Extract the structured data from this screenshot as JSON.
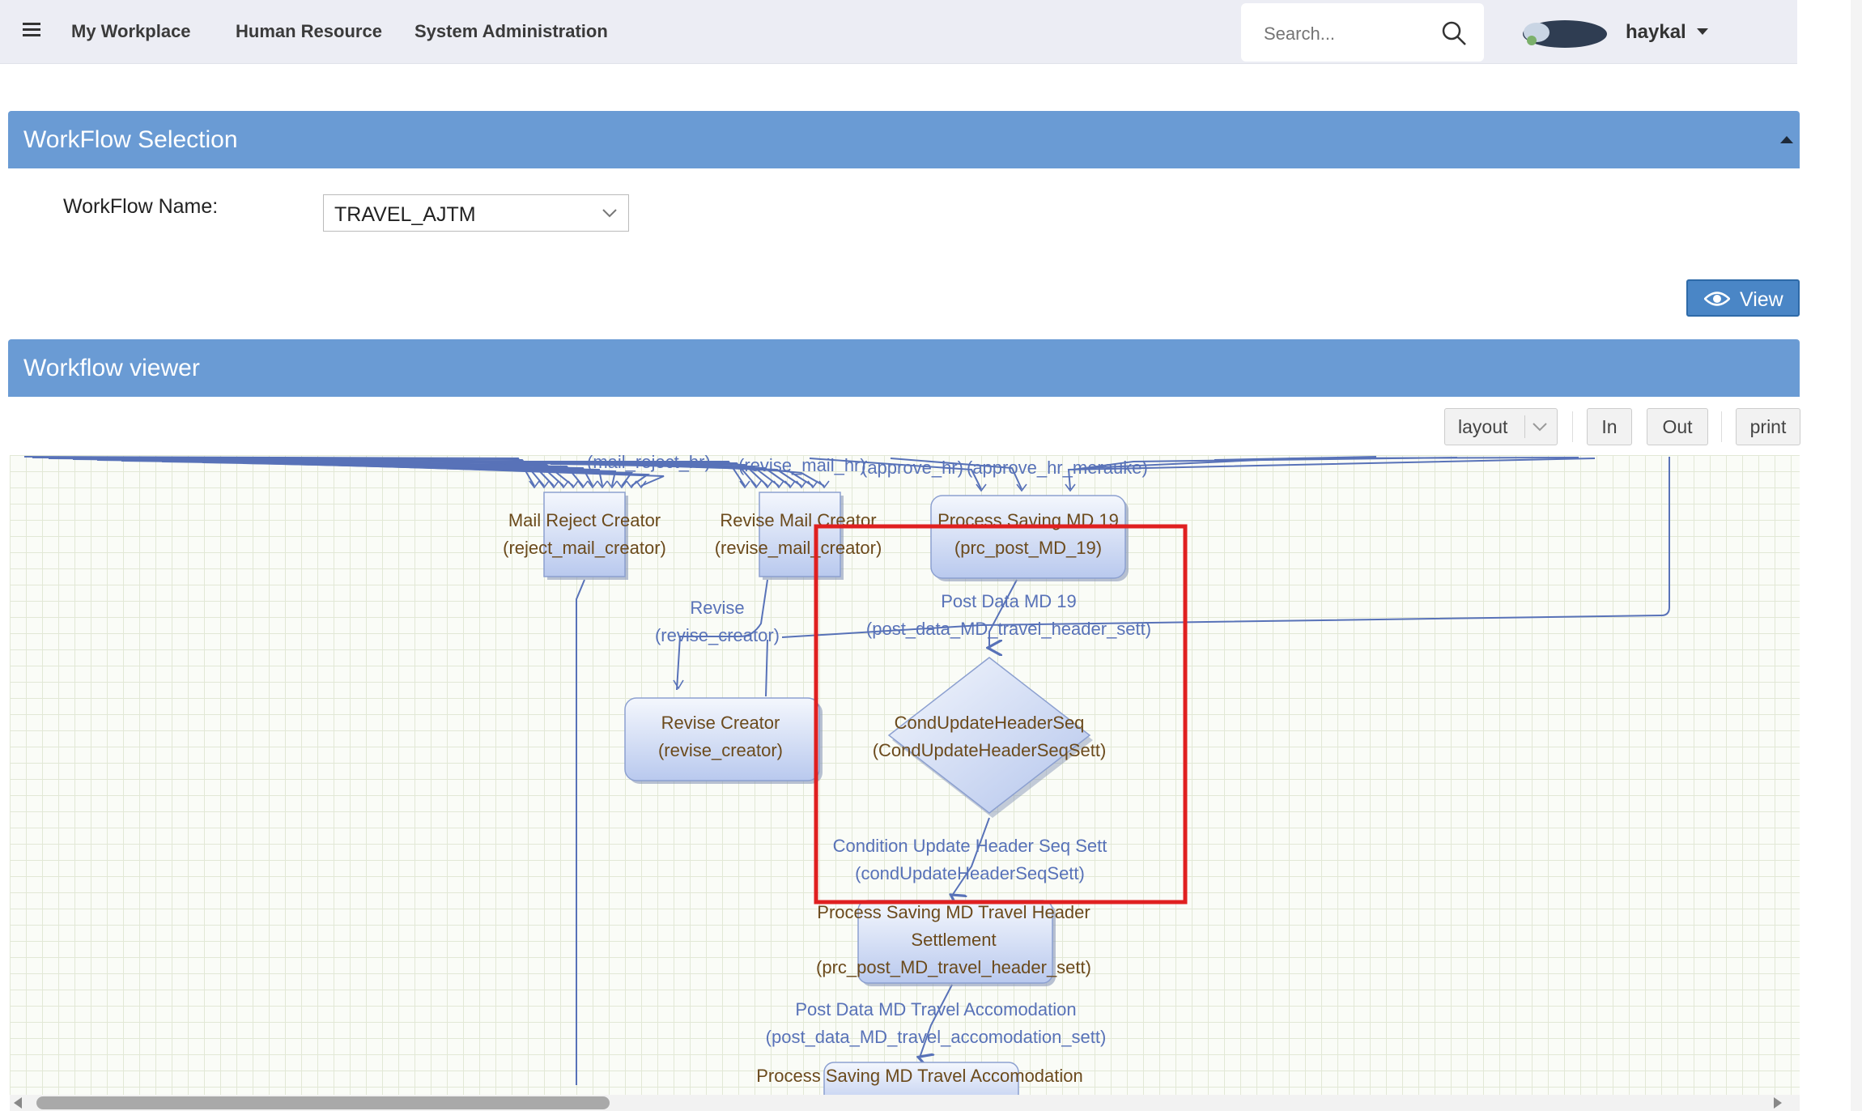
{
  "nav": {
    "menu_icon": "hamburger-icon",
    "links": [
      "My Workplace",
      "Human Resource",
      "System Administration"
    ],
    "search_placeholder": "Search...",
    "search_icon": "search-icon",
    "user_name": "haykal"
  },
  "selection_panel": {
    "title": "WorkFlow Selection",
    "workflow_label": "WorkFlow Name:",
    "workflow_value": "TRAVEL_AJTM",
    "view_button": "View"
  },
  "viewer_panel": {
    "title": "Workflow viewer",
    "toolbar": {
      "layout": "layout",
      "zoom_in": "In",
      "zoom_out": "Out",
      "print": "print"
    }
  },
  "diagram": {
    "top_edge_labels": [
      "(mail_reject_hr)",
      "(revise_mail_hr)",
      "(approve_hr)",
      "(approve_hr_merauke)"
    ],
    "nodes": {
      "mail_reject": [
        "Mail Reject Creator",
        "(reject_mail_creator)"
      ],
      "revise_mail": [
        "Revise Mail Creator",
        "(revise_mail_creator)"
      ],
      "process_md19": [
        "Process Saving MD 19",
        "(prc_post_MD_19)"
      ],
      "revise_creator": [
        "Revise Creator",
        "(revise_creator)"
      ],
      "cond_update": [
        "CondUpdateHeaderSeq",
        "(CondUpdateHeaderSeqSett)"
      ],
      "process_header": [
        "Process Saving MD Travel Header",
        "Settlement",
        "(prc_post_MD_travel_header_sett)"
      ],
      "process_accomodation": [
        "Process Saving MD Travel Accomodation"
      ]
    },
    "edges": {
      "revise": [
        "Revise",
        "(revise_creator)"
      ],
      "post_md19": [
        "Post Data MD 19",
        "(post_data_MD_travel_header_sett)"
      ],
      "cond_update": [
        "Condition Update Header Seq Sett",
        "(condUpdateHeaderSeqSett)"
      ],
      "post_accomodation": [
        "Post Data MD Travel Accomodation",
        "(post_data_MD_travel_accomodation_sett)"
      ]
    },
    "highlight_color": "#e02020",
    "node_text_color": "#6b4a1c",
    "edge_color": "#5872b8"
  }
}
